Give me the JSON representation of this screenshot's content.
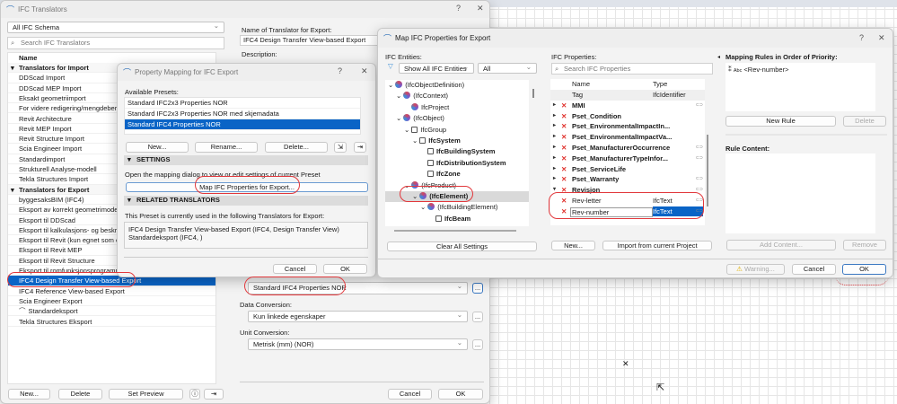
{
  "translators": {
    "title": "IFC Translators",
    "schema_select": "All IFC Schema",
    "search_placeholder": "Search IFC Translators",
    "col_name": "Name",
    "rows": [
      {
        "label": "Translators for Import",
        "group": true
      },
      {
        "label": "DDScad Import"
      },
      {
        "label": "DDScad MEP Import"
      },
      {
        "label": "Eksakt geometriimport"
      },
      {
        "label": "For videre redigering/mengdeberegning"
      },
      {
        "label": "Revit Architecture"
      },
      {
        "label": "Revit MEP Import"
      },
      {
        "label": "Revit Structure Import"
      },
      {
        "label": "Scia Engineer Import"
      },
      {
        "label": "Standardimport"
      },
      {
        "label": "Strukturell Analyse-modell"
      },
      {
        "label": "Tekla Structures Import"
      },
      {
        "label": "Translators for Export",
        "group": true
      },
      {
        "label": "byggesaksBIM (IFC4)"
      },
      {
        "label": "Eksport av korrekt geometrimodell (kun"
      },
      {
        "label": "Eksport til DDScad"
      },
      {
        "label": "Eksport til kalkulasjons- og beskrivelse"
      },
      {
        "label": "Eksport til Revit (kun egnet som en lin"
      },
      {
        "label": "Eksport til Revit MEP"
      },
      {
        "label": "Eksport til Revit Structure"
      },
      {
        "label": "Eksport til romfunksjonsprogrammer ("
      },
      {
        "label": "IFC4 Design Transfer View-based Export",
        "selected": true
      },
      {
        "label": "IFC4 Reference View-based Export"
      },
      {
        "label": "Scia Engineer Export"
      },
      {
        "label": "Standardeksport",
        "icon": "archicad-icon"
      },
      {
        "label": "Tekla Structures Eksport"
      }
    ],
    "buttons": {
      "new": "New...",
      "delete": "Delete",
      "set_preview": "Set Preview"
    },
    "name_label": "Name of Translator for Export:",
    "name_value": "IFC4 Design Transfer View-based Export",
    "description_label": "Description:",
    "property_mapping_select": "Standard IFC4 Properties NOR",
    "data_conversion_label": "Data Conversion:",
    "data_conversion_value": "Kun linkede egenskaper",
    "unit_conversion_label": "Unit Conversion:",
    "unit_conversion_value": "Metrisk (mm) (NOR)",
    "more": "...",
    "cancel": "Cancel",
    "ok": "OK",
    "help": "?",
    "close": "✕"
  },
  "property_mapping": {
    "title": "Property Mapping for IFC Export",
    "presets_label": "Available Presets:",
    "presets": [
      "Standard IFC2x3 Properties NOR",
      "Standard IFC2x3 Properties NOR med skjemadata",
      "Standard IFC4 Properties NOR"
    ],
    "selected_preset": 2,
    "new": "New...",
    "rename": "Rename...",
    "delete": "Delete...",
    "settings_header": "SETTINGS",
    "settings_text": "Open the mapping dialog to view or edit settings of current Preset",
    "map_button": "Map IFC Properties for Export...",
    "related_header": "RELATED TRANSLATORS",
    "related_text": "This Preset is currently used in the following Translators for Export:",
    "related_items": [
      "IFC4 Design Transfer View-based Export (IFC4, Design Transfer View)",
      "Standardeksport (IFC4, )"
    ],
    "cancel": "Cancel",
    "ok": "OK"
  },
  "map_dialog": {
    "title": "Map IFC Properties for Export",
    "entities_label": "IFC Entities:",
    "entity_filter": "Show All IFC Entities",
    "entity_scope": "All",
    "tree": [
      {
        "label": "(IfcObjectDefinition)",
        "level": 0,
        "expanded": true
      },
      {
        "label": "(IfcContext)",
        "level": 1,
        "expanded": true
      },
      {
        "label": "IfcProject",
        "level": 2
      },
      {
        "label": "(IfcObject)",
        "level": 1,
        "expanded": true
      },
      {
        "label": "IfcGroup",
        "level": 2,
        "expanded": true,
        "icon": "system"
      },
      {
        "label": "IfcSystem",
        "level": 3,
        "expanded": true,
        "icon": "system",
        "bold": true
      },
      {
        "label": "IfcBuildingSystem",
        "level": 4,
        "icon": "system",
        "bold": true
      },
      {
        "label": "IfcDistributionSystem",
        "level": 4,
        "icon": "system",
        "bold": true
      },
      {
        "label": "IfcZone",
        "level": 4,
        "icon": "system",
        "bold": true
      },
      {
        "label": "(IfcProduct)",
        "level": 2,
        "expanded": true
      },
      {
        "label": "(IfcElement)",
        "level": 3,
        "expanded": true,
        "selected": true,
        "bold": true
      },
      {
        "label": "(IfcBuildingElement)",
        "level": 4,
        "expanded": true
      },
      {
        "label": "IfcBeam",
        "level": 5,
        "icon": "beam",
        "bold": true
      }
    ],
    "clear_all": "Clear All Settings",
    "properties_label": "IFC Properties:",
    "properties_search_placeholder": "Search IFC Properties",
    "col_name": "Name",
    "col_type": "Type",
    "properties": [
      {
        "name": "Tag",
        "type": "IfcIdentifier",
        "plain": true
      },
      {
        "name": "MMI",
        "expand": "▸",
        "link": true
      },
      {
        "name": "Pset_Condition",
        "expand": "▸"
      },
      {
        "name": "Pset_EnvironmentalImpactIn...",
        "expand": "▸"
      },
      {
        "name": "Pset_EnvironmentalImpactVa...",
        "expand": "▸"
      },
      {
        "name": "Pset_ManufacturerOccurrence",
        "expand": "▸",
        "link": true
      },
      {
        "name": "Pset_ManufacturerTypeInfor...",
        "expand": "▸",
        "link": true
      },
      {
        "name": "Pset_ServiceLife",
        "expand": "▸"
      },
      {
        "name": "Pset_Warranty",
        "expand": "▸",
        "link": true
      },
      {
        "name": "Revisjon",
        "expand": "▾",
        "link": true
      },
      {
        "name": "Rev-letter",
        "type": "IfcText",
        "child": true,
        "link": true
      },
      {
        "name": "Rev-number",
        "type": "IfcText",
        "child": true,
        "selected": true,
        "link": true
      }
    ],
    "new": "New...",
    "import": "Import from current Project",
    "rules_label": "Mapping Rules in Order of Priority:",
    "rules": [
      {
        "type": "Abc",
        "value": "<Rev-number>"
      }
    ],
    "new_rule": "New Rule",
    "delete": "Delete",
    "rule_content_label": "Rule Content:",
    "add_content": "Add Content...",
    "remove": "Remove",
    "warning": "Warning...",
    "cancel": "Cancel",
    "ok": "OK",
    "help": "?",
    "close": "✕"
  },
  "colors": {
    "accent": "#0a64c6",
    "highlight_ring": "#e2383c",
    "delete_mark": "#e0302b"
  }
}
